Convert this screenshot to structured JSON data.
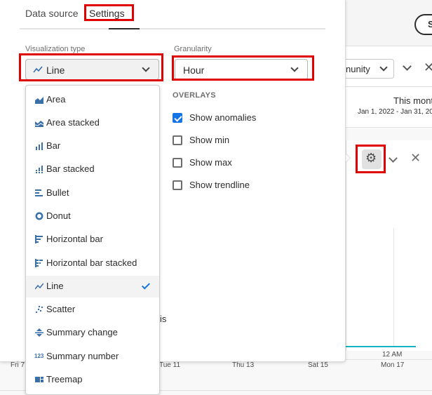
{
  "tabs": [
    {
      "label": "Data source",
      "active": false
    },
    {
      "label": "Settings",
      "active": true
    }
  ],
  "visualization": {
    "label": "Visualization type",
    "selected": "Line",
    "options": [
      {
        "label": "Area",
        "icon": "area-chart-icon"
      },
      {
        "label": "Area stacked",
        "icon": "area-stacked-chart-icon"
      },
      {
        "label": "Bar",
        "icon": "bar-chart-icon"
      },
      {
        "label": "Bar stacked",
        "icon": "bar-stacked-chart-icon"
      },
      {
        "label": "Bullet",
        "icon": "bullet-chart-icon"
      },
      {
        "label": "Donut",
        "icon": "donut-chart-icon"
      },
      {
        "label": "Horizontal bar",
        "icon": "horizontal-bar-chart-icon"
      },
      {
        "label": "Horizontal bar stacked",
        "icon": "horizontal-bar-stacked-chart-icon"
      },
      {
        "label": "Line",
        "icon": "line-chart-icon",
        "selected": true
      },
      {
        "label": "Scatter",
        "icon": "scatter-chart-icon"
      },
      {
        "label": "Summary change",
        "icon": "summary-change-icon"
      },
      {
        "label": "Summary number",
        "icon": "summary-number-icon"
      },
      {
        "label": "Treemap",
        "icon": "treemap-icon"
      }
    ]
  },
  "granularity": {
    "label": "Granularity",
    "value": "Hour"
  },
  "overlays": {
    "title": "OVERLAYS",
    "items": [
      {
        "label": "Show anomalies",
        "checked": true
      },
      {
        "label": "Show min",
        "checked": false
      },
      {
        "label": "Show max",
        "checked": false
      },
      {
        "label": "Show trendline",
        "checked": false
      }
    ]
  },
  "background": {
    "top_button": "S",
    "segment": "nunity",
    "date_title": "This mont",
    "date_range": "Jan 1, 2022 - Jan 31, 202",
    "partial_text": "is",
    "ticks": [
      "Fri 7",
      "Tue 11",
      "Thu 13",
      "Sat 15",
      "Mon 17"
    ],
    "time_tick": "12 AM"
  },
  "colors": {
    "accent": "#1473e6",
    "highlight": "#e00000",
    "trendline": "#12b5c1"
  }
}
